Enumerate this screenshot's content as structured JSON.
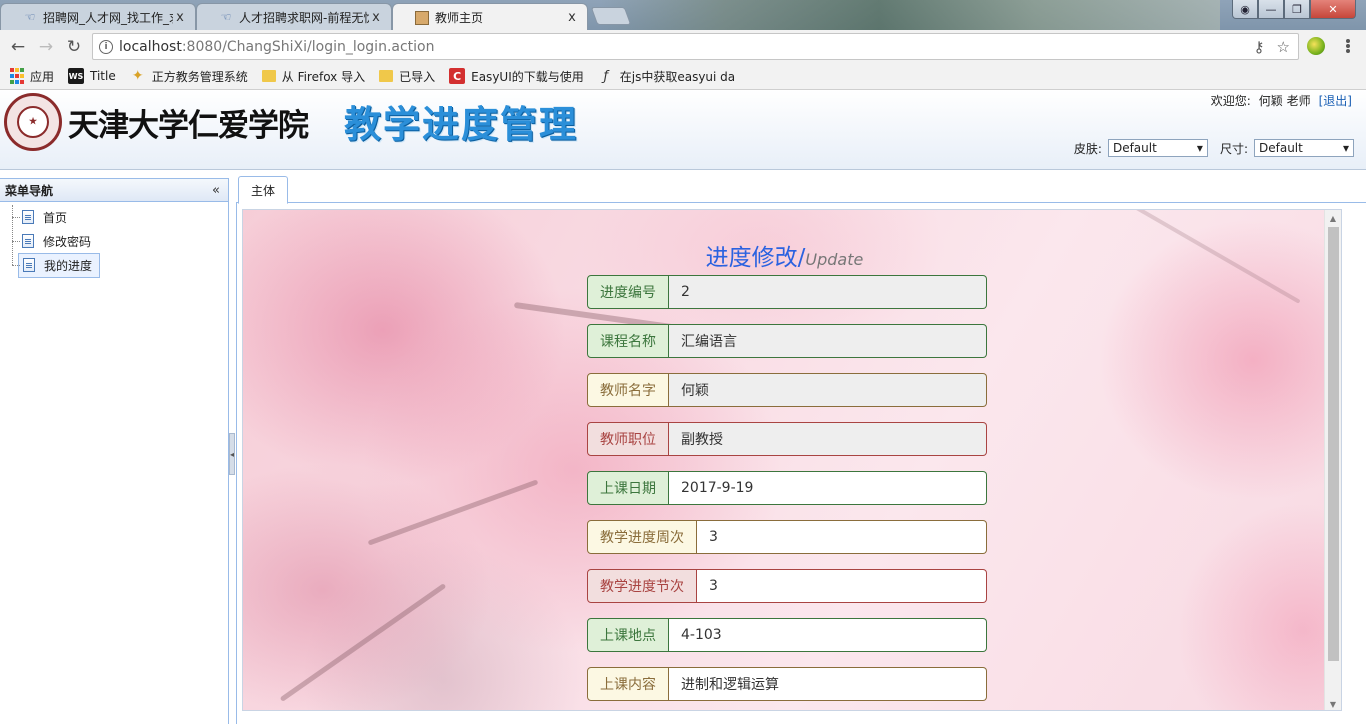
{
  "browser": {
    "tabs": [
      {
        "title": "招聘网_人才网_找工作_求",
        "icon": "hand-icon",
        "active": false
      },
      {
        "title": "人才招聘求职网-前程无忧",
        "icon": "hand-icon",
        "active": false
      },
      {
        "title": "教师主页",
        "icon": "page-icon",
        "active": true
      }
    ],
    "close_glyph": "x",
    "url_host": "localhost",
    "url_rest": ":8080/ChangShiXi/login_login.action",
    "bookmarks": [
      {
        "label": "应用",
        "icon": "apps-icon"
      },
      {
        "label": "Title",
        "icon": "ws-icon"
      },
      {
        "label": "正方教务管理系统",
        "icon": "zf-icon"
      },
      {
        "label": "从 Firefox 导入",
        "icon": "folder-icon"
      },
      {
        "label": "已导入",
        "icon": "folder-icon"
      },
      {
        "label": "EasyUI的下载与使用",
        "icon": "c-icon"
      },
      {
        "label": "在js中获取easyui da",
        "icon": "function-icon"
      }
    ]
  },
  "header": {
    "school_name": "天津大学仁爱学院",
    "system_title": "教学进度管理",
    "welcome_label": "欢迎您:",
    "user_name": "何颖 老师",
    "logout_label": "[退出]",
    "skin_label": "皮肤:",
    "skin_value": "Default",
    "size_label": "尺寸:",
    "size_value": "Default"
  },
  "sidebar": {
    "title": "菜单导航",
    "collapse_glyph": "«",
    "items": [
      {
        "label": "首页",
        "selected": false
      },
      {
        "label": "修改密码",
        "selected": false
      },
      {
        "label": "我的进度",
        "selected": true
      }
    ]
  },
  "center": {
    "tab_label": "主体"
  },
  "form": {
    "title_cn": "进度修改/",
    "title_en": "Update",
    "fields": [
      {
        "label": "进度编号",
        "value": "2",
        "style": "success",
        "readonly": true
      },
      {
        "label": "课程名称",
        "value": "汇编语言",
        "style": "success",
        "readonly": true
      },
      {
        "label": "教师名字",
        "value": "何颖",
        "style": "warning",
        "readonly": true
      },
      {
        "label": "教师职位",
        "value": "副教授",
        "style": "danger",
        "readonly": true
      },
      {
        "label": "上课日期",
        "value": "2017-9-19",
        "style": "success",
        "readonly": false
      },
      {
        "label": "教学进度周次",
        "value": "3",
        "style": "warning",
        "readonly": false
      },
      {
        "label": "教学进度节次",
        "value": "3",
        "style": "danger",
        "readonly": false
      },
      {
        "label": "上课地点",
        "value": "4-103",
        "style": "success",
        "readonly": false
      },
      {
        "label": "上课内容",
        "value": "进制和逻辑运算",
        "style": "warning",
        "readonly": false
      }
    ]
  },
  "colors": {
    "accent": "#2b8fd9",
    "success": "#3c763d",
    "warning": "#8a6d3b",
    "danger": "#a94442"
  }
}
